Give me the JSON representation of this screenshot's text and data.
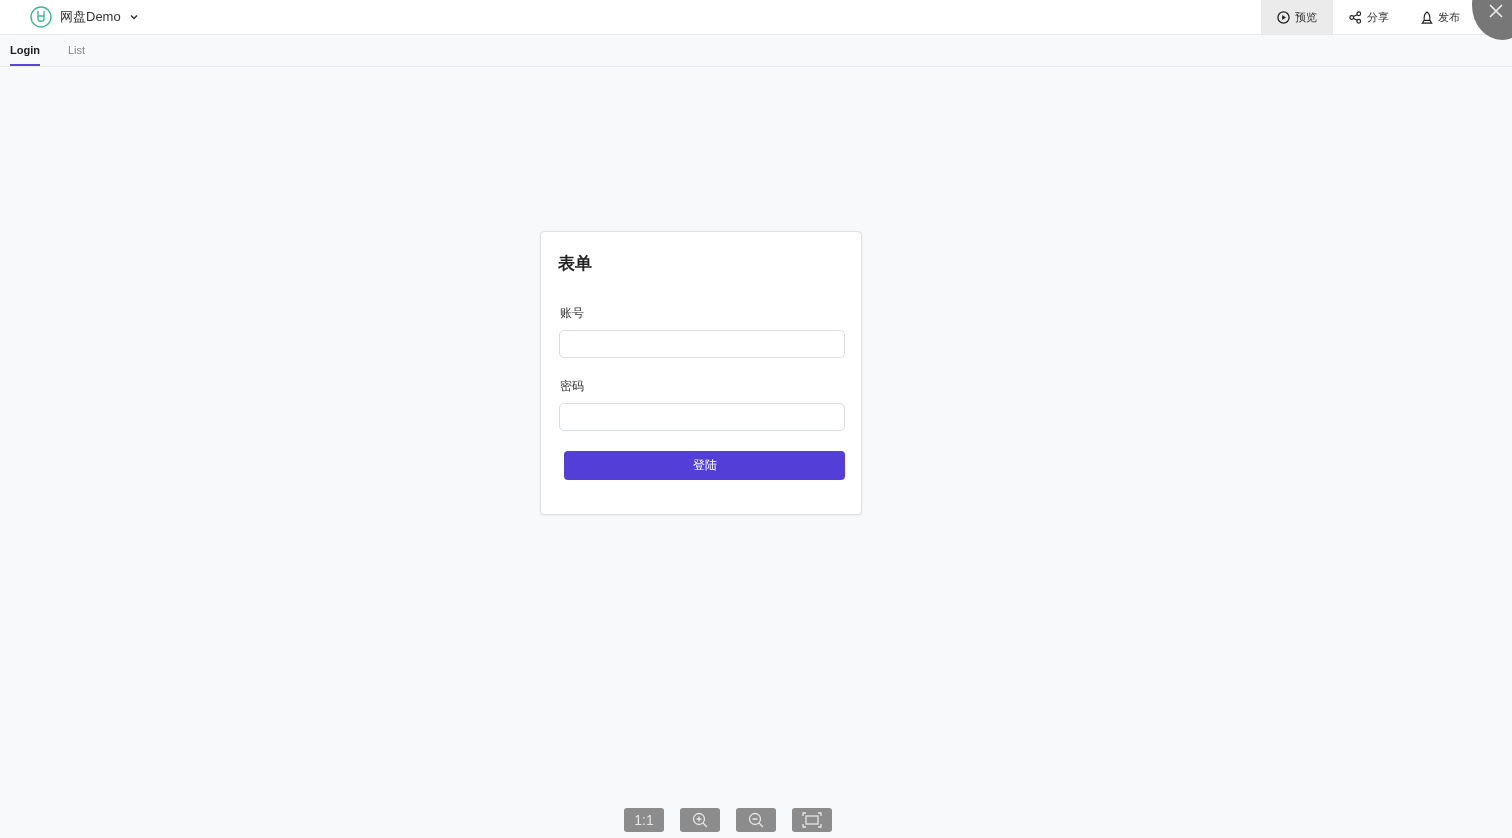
{
  "header": {
    "project": "网盘Demo",
    "actions": [
      {
        "kind": "preview",
        "label": "预览",
        "selected": true
      },
      {
        "kind": "share",
        "label": "分享",
        "selected": false
      },
      {
        "kind": "publish",
        "label": "发布",
        "selected": false
      }
    ]
  },
  "tabs": [
    {
      "label": "Login",
      "selected": true
    },
    {
      "label": "List",
      "selected": false
    }
  ],
  "form": {
    "title": "表单",
    "fields": [
      {
        "label": "账号"
      },
      {
        "label": "密码"
      }
    ],
    "submit": "登陆"
  },
  "zoom_toolbar": [
    {
      "kind": "actual",
      "label": "1:1"
    },
    {
      "kind": "zoom-in"
    },
    {
      "kind": "zoom-out"
    },
    {
      "kind": "fit"
    }
  ]
}
